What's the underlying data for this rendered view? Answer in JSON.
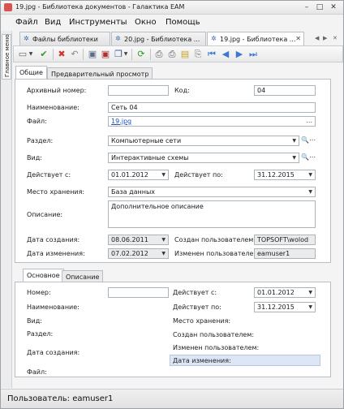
{
  "window": {
    "title": "19.jpg - Библиотека документов - Галактика EAM",
    "controls": {
      "minimize": "–",
      "maximize": "□",
      "close": "✕"
    }
  },
  "menu": {
    "items": [
      "Файл",
      "Вид",
      "Инструменты",
      "Окно",
      "Помощь"
    ]
  },
  "side_panel": {
    "label": "Главное меню"
  },
  "doc_tabs": [
    {
      "label": "Файлы библиотеки",
      "icon": "gear-icon"
    },
    {
      "label": "20.jpg - Библиотека ...",
      "icon": "gear-icon"
    },
    {
      "label": "19.jpg - Библиотека ...",
      "icon": "gear-icon",
      "active": true
    }
  ],
  "toolbar": {
    "buttons": [
      "new-document-icon",
      "dropdown-icon",
      "accept-icon",
      "cancel-icon",
      "undo-icon",
      "save-icon",
      "save-close-icon",
      "copy-icon",
      "refresh-icon",
      "print-preview-icon",
      "print-icon",
      "open-folder-icon",
      "attach-icon",
      "first-record-icon",
      "prev-record-icon",
      "next-record-icon",
      "last-record-icon"
    ]
  },
  "form_tabs": [
    {
      "label": "Общие",
      "active": true
    },
    {
      "label": "Предварительный просмотр",
      "active": false
    }
  ],
  "form": {
    "archive_number": {
      "label": "Архивный номер:",
      "value": ""
    },
    "code": {
      "label": "Код:",
      "value": "04"
    },
    "name": {
      "label": "Наименование:",
      "value": "Сеть 04"
    },
    "file": {
      "label": "Файл:",
      "value": "19.jpg",
      "button": "..."
    },
    "section": {
      "label": "Раздел:",
      "value": "Компьютерные сети"
    },
    "kind": {
      "label": "Вид:",
      "value": "Интерактивные схемы"
    },
    "valid_from": {
      "label": "Действует с:",
      "value": "01.01.2012"
    },
    "valid_to": {
      "label": "Действует по:",
      "value": "31.12.2015"
    },
    "storage": {
      "label": "Место хранения:",
      "value": "База данных"
    },
    "description": {
      "label": "Описание:",
      "value": "Дополнительное описание"
    },
    "created_date": {
      "label": "Дата создания:",
      "value": "08.06.2011"
    },
    "created_by": {
      "label": "Создан пользователем:",
      "value": "TOPSOFT\\wolod"
    },
    "modified_date": {
      "label": "Дата изменения:",
      "value": "07.02.2012"
    },
    "modified_by": {
      "label": "Изменен пользователем:",
      "value": "eamuser1"
    }
  },
  "sub_tabs": [
    {
      "label": "Основное",
      "active": true
    },
    {
      "label": "Описание",
      "active": false
    }
  ],
  "sub_form": {
    "number_label": "Номер:",
    "name_label": "Наименование:",
    "kind_label": "Вид:",
    "section_label": "Раздел:",
    "created_label": "Дата создания:",
    "file_label": "Файл:",
    "valid_from_label": "Действует с:",
    "valid_from_value": "01.01.2012",
    "valid_to_label": "Действует по:",
    "valid_to_value": "31.12.2015",
    "storage_label": "Место хранения:",
    "created_by_label": "Создан пользователем:",
    "modified_by_label": "Изменен пользователем:",
    "modified_date_label": "Дата изменения:"
  },
  "status": {
    "text": "Пользователь: eamuser1"
  }
}
